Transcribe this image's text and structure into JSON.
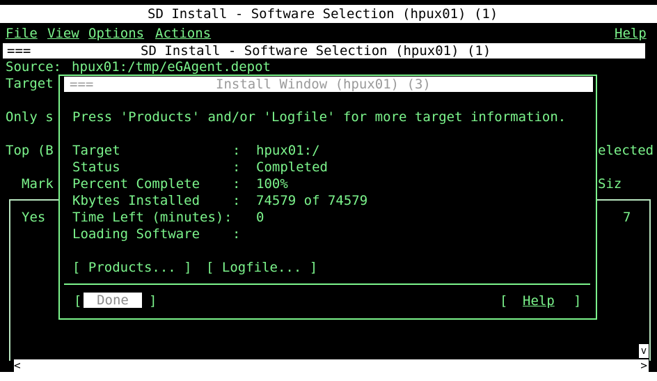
{
  "window": {
    "title": "SD Install - Software Selection (hpux01) (1)"
  },
  "menubar": {
    "file": "File",
    "view": "View",
    "options": "Options",
    "actions": "Actions",
    "help": "Help"
  },
  "inner_window": {
    "marker": "===",
    "title": "SD Install - Software Selection (hpux01) (1)"
  },
  "background": {
    "source_label": "Source:",
    "source_value": "hpux01:/tmp/eGAgent.depot",
    "target_frag": "Target",
    "only_frag": "Only s",
    "top_frag": "Top (B",
    "selected_frag": "elected",
    "mark_frag": "Mark",
    "size_frag": "Siz",
    "yes_frag": "Yes",
    "seven_frag": "7"
  },
  "dialog": {
    "marker": "===",
    "title": "Install Window (hpux01) (3)",
    "instructions": "Press 'Products' and/or 'Logfile' for more target information.",
    "fields": [
      {
        "label": "Target",
        "value": "hpux01:/"
      },
      {
        "label": "Status",
        "value": "Completed"
      },
      {
        "label": "Percent Complete",
        "value": "100%"
      },
      {
        "label": "Kbytes Installed",
        "value": "74579 of 74579"
      },
      {
        "label": "Time Left (minutes)",
        "value": "0"
      },
      {
        "label": "Loading Software",
        "value": ""
      }
    ],
    "colon": ":",
    "products_button": "[ Products... ]",
    "logfile_button": "[ Logfile... ]",
    "done_open": "[",
    "done_label": "Done",
    "done_close": "]",
    "help_open": "[",
    "help_label": "Help",
    "help_close": "]"
  },
  "scrollbar": {
    "down_arrow": "v",
    "left_arrow": "<",
    "right_arrow": ">"
  }
}
